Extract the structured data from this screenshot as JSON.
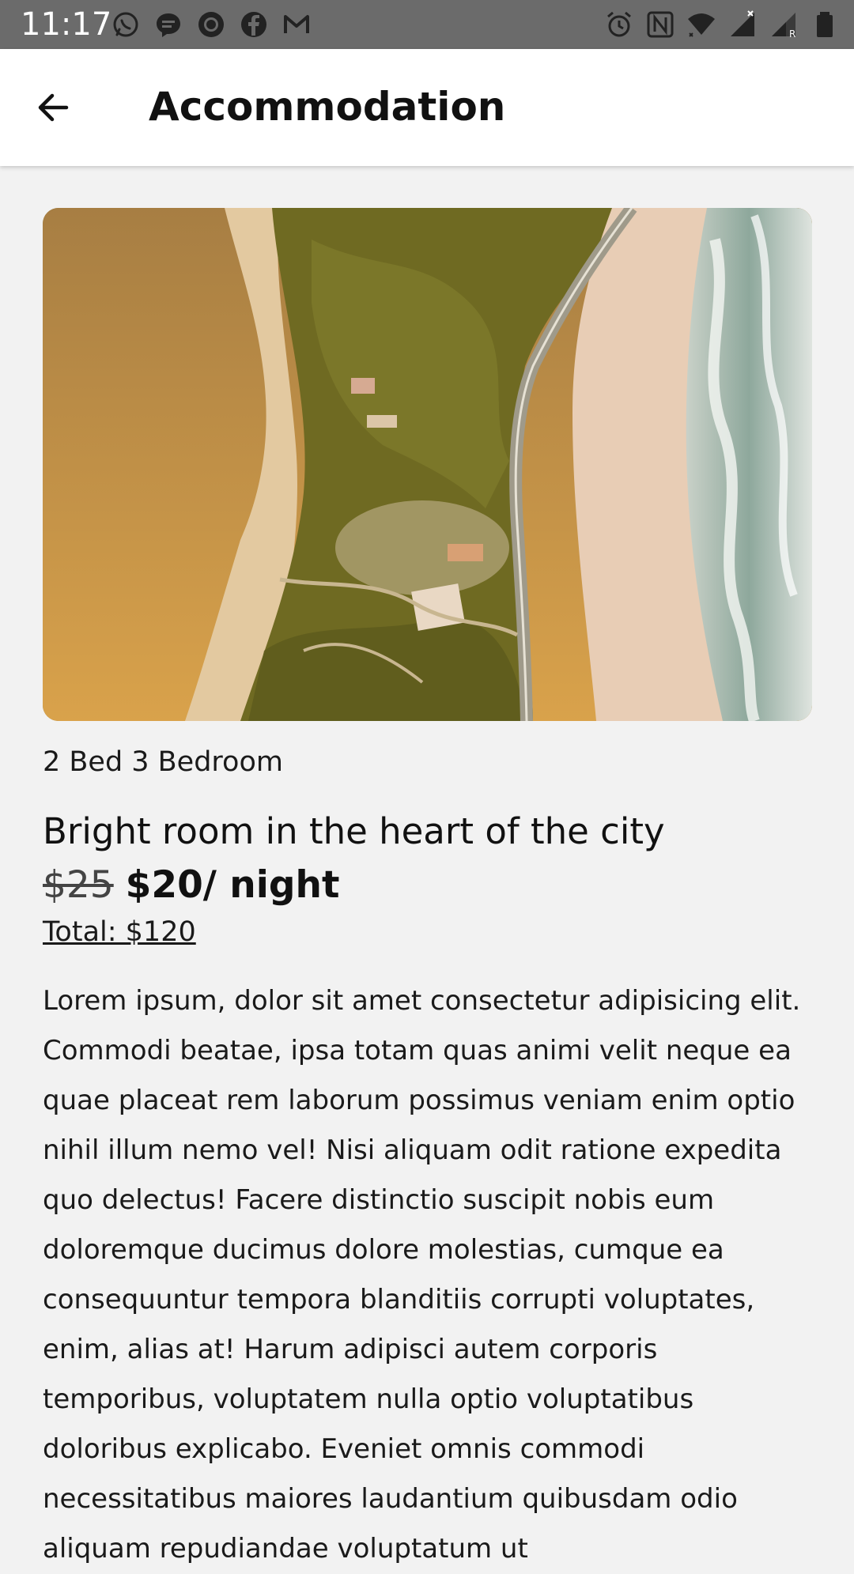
{
  "status_bar": {
    "time": "11:17",
    "left_icons": [
      "whatsapp-icon",
      "messenger-icon",
      "record-icon",
      "facebook-icon",
      "gmail-icon"
    ],
    "right_icons": [
      "alarm-icon",
      "nfc-icon",
      "wifi-icon",
      "signal-icon",
      "signal-roaming-icon",
      "battery-icon"
    ],
    "background": "#6b6b6b"
  },
  "header": {
    "back_icon": "arrow-back-icon",
    "title": "Accommodation"
  },
  "listing": {
    "image_alt": "Aerial view of a coastal road between forest and beach",
    "room_type": "2 Bed 3 Bedroom",
    "title": "Bright room in the heart of the city",
    "old_price": "$25",
    "new_price": "$20",
    "price_unit": "/ night",
    "total": "Total: $120",
    "description": "Lorem ipsum, dolor sit amet consectetur adipisicing elit. Commodi beatae, ipsa totam quas animi velit neque ea quae placeat rem laborum possimus veniam enim optio nihil illum nemo vel! Nisi aliquam odit ratione expedita quo delectus! Facere distinctio suscipit nobis eum doloremque ducimus dolore molestias, cumque ea consequuntur tempora blanditiis corrupti voluptates, enim, alias at! Harum adipisci autem corporis temporibus, voluptatem nulla optio voluptatibus doloribus explicabo. Eveniet omnis commodi necessitatibus maiores laudantium quibusdam odio aliquam repudiandae voluptatum ut"
  },
  "colors": {
    "background": "#f2f2f2",
    "app_bar": "#ffffff",
    "text": "#111111"
  }
}
